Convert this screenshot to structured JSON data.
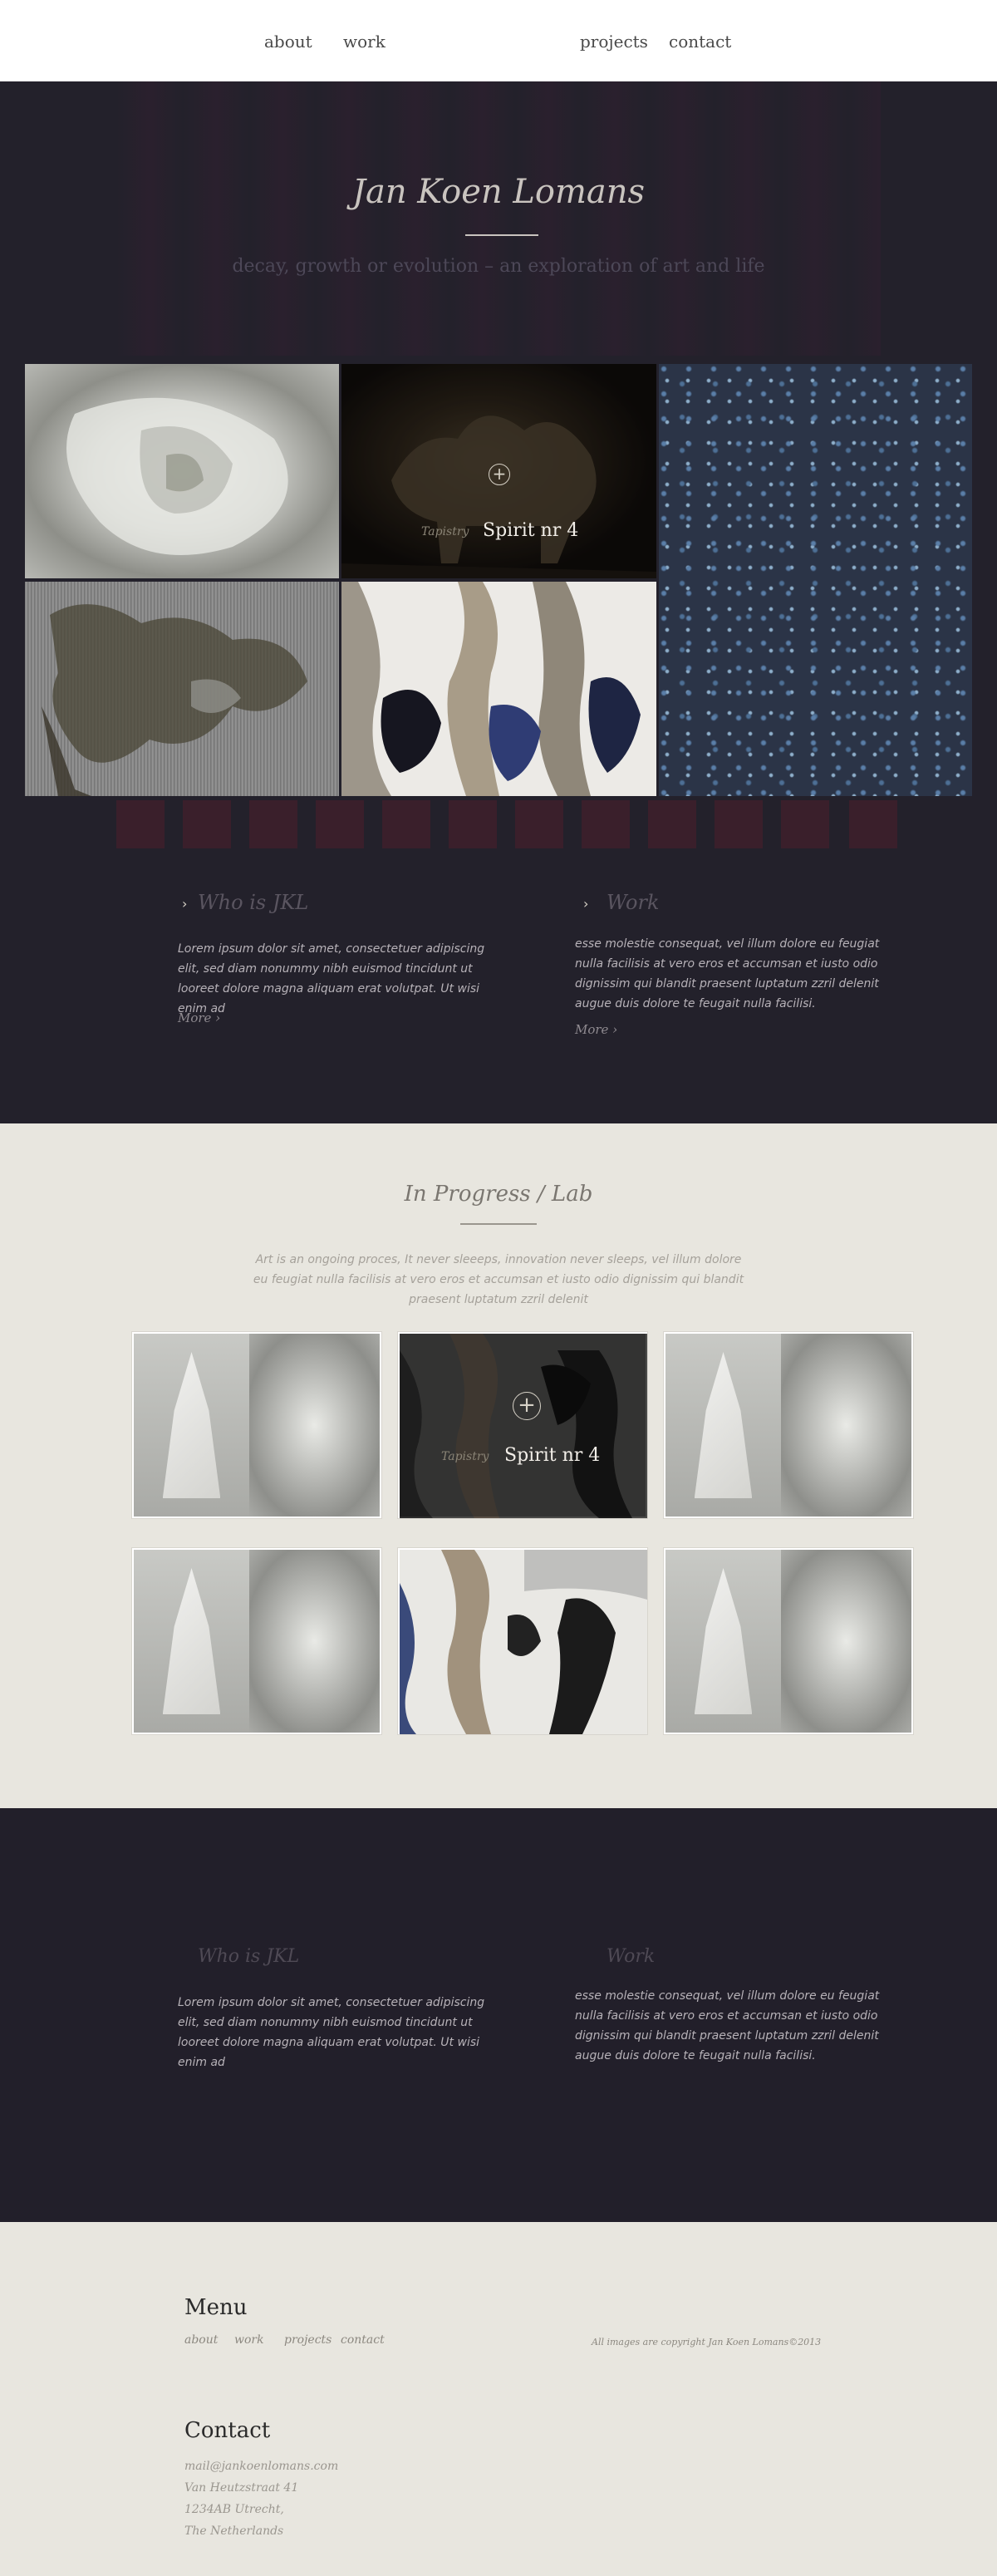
{
  "nav": {
    "items": [
      "about",
      "work",
      "projects",
      "contact"
    ]
  },
  "hero": {
    "title": "Jan Koen Lomans",
    "subtitle": "decay, growth or evolution – an exploration of art and life"
  },
  "gallery": {
    "overlay": {
      "category": "Tapistry",
      "title": "Spirit nr 4"
    }
  },
  "about_block": {
    "left": {
      "heading": "Who is JKL",
      "text": "Lorem ipsum dolor sit amet, consectetuer adipiscing elit, sed diam nonummy nibh euismod tincidunt ut looreet dolore magna aliquam erat volutpat. Ut wisi enim ad",
      "more": "More"
    },
    "right": {
      "heading": "Work",
      "text": "esse molestie consequat, vel illum dolore eu feugiat nulla facilisis at vero eros et accumsan et iusto odio dignissim qui blandit praesent luptatum zzril delenit augue duis dolore te feugait nulla facilisi.",
      "more": "More"
    }
  },
  "lab": {
    "title": "In Progress / Lab",
    "text": "Art is an ongoing proces, It never sleeeps, innovation never sleeps, vel illum dolore eu feugiat nulla facilisis at vero eros et accumsan et iusto odio dignissim qui blandit praesent luptatum zzril delenit",
    "overlay": {
      "category": "Tapistry",
      "title": "Spirit nr 4"
    }
  },
  "info": {
    "left": {
      "heading": "Who is JKL",
      "text": "Lorem ipsum dolor sit amet, consectetuer adipiscing elit, sed diam nonummy nibh euismod tincidunt ut looreet dolore magna aliquam erat volutpat. Ut wisi enim ad"
    },
    "right": {
      "heading": "Work",
      "text": "esse molestie consequat, vel illum dolore eu feugiat nulla facilisis at vero eros et accumsan et iusto odio dignissim qui blandit praesent luptatum zzril delenit augue duis dolore te feugait nulla facilisi."
    }
  },
  "footer": {
    "menu_heading": "Menu",
    "menu": [
      "about",
      "work",
      "projects",
      "contact"
    ],
    "copyright": "All images are copyright Jan Koen Lomans©2013",
    "contact_heading": "Contact",
    "contact_lines": [
      "mail@jankoenlomans.com",
      "Van Heutzstraat 41",
      "1234AB Utrecht,",
      "The Netherlands"
    ]
  },
  "colors": {
    "dark_bg": "#23212b",
    "light_bg": "#e8e6df",
    "accent_thumb": "#3a1f2b"
  }
}
